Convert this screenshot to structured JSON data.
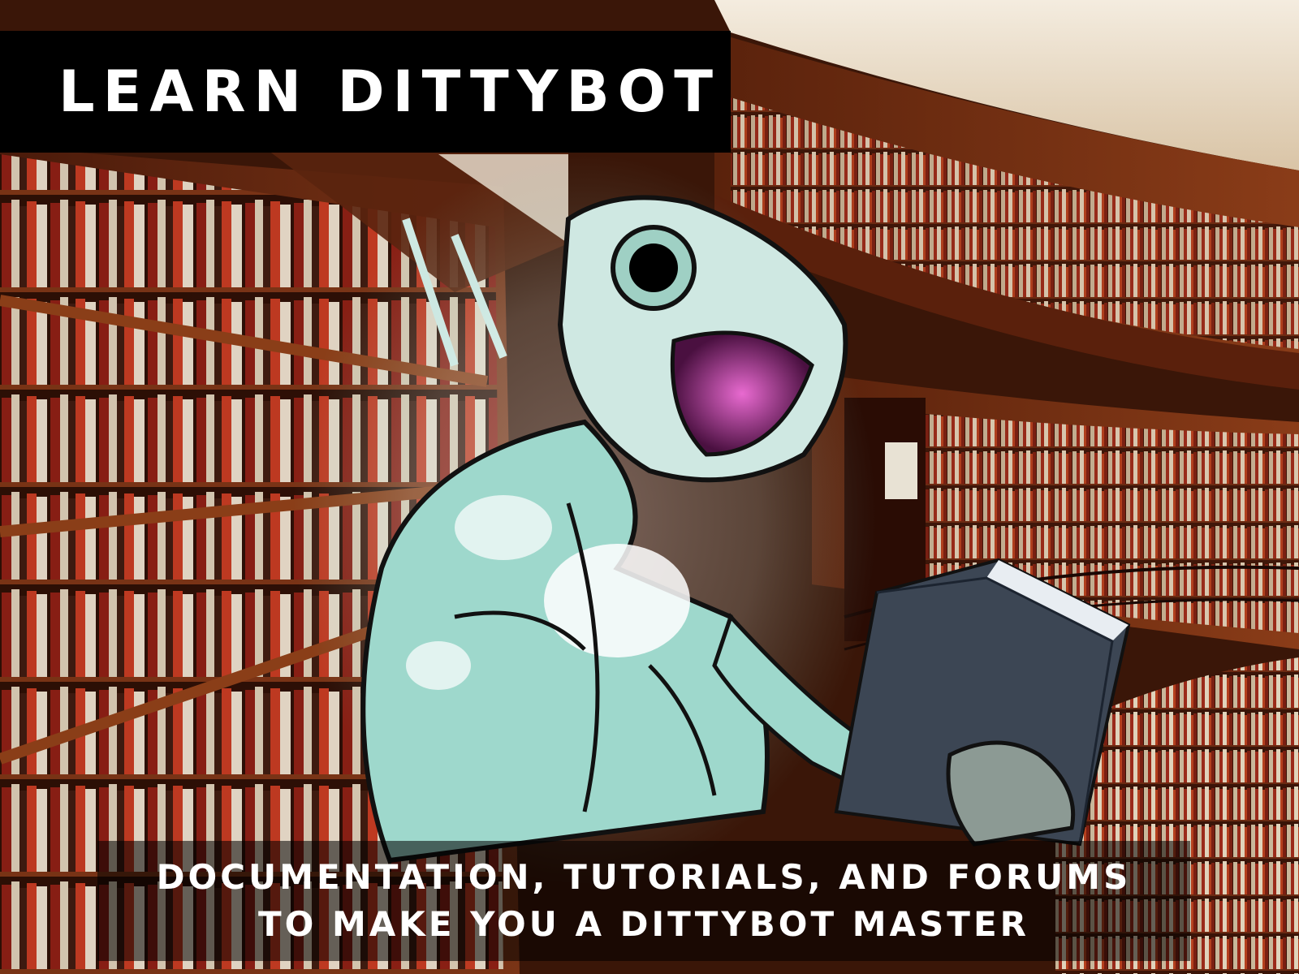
{
  "banner": {
    "title": "LEARN DITTYBOT"
  },
  "caption": {
    "line1": "DOCUMENTATION, TUTORIALS, AND FORUMS",
    "line2": "TO MAKE YOU A DITTYBOT MASTER"
  },
  "illustration": {
    "scene": "library-background",
    "character": "robot-reading-book-illustration"
  },
  "colors": {
    "banner_bg": "#000000",
    "text": "#ffffff",
    "wood": "#6b2a12",
    "robot_teal": "#8fd6c8"
  }
}
